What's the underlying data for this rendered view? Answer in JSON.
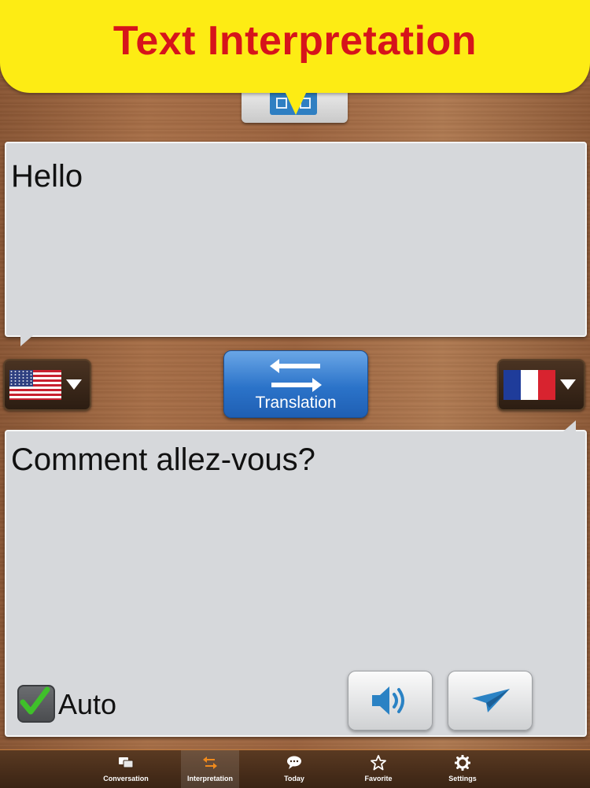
{
  "banner": {
    "title": "Text Interpretation"
  },
  "source": {
    "text": "Hello",
    "language_flag": "us-flag"
  },
  "target": {
    "text": "Comment allez-vous?",
    "language_flag": "france-flag"
  },
  "translate_button": {
    "label": "Translation",
    "icon": "swap-arrows-icon"
  },
  "auto": {
    "label": "Auto",
    "checked": true
  },
  "actions": {
    "speak_icon": "speaker-icon",
    "send_icon": "paper-plane-icon"
  },
  "tabs": [
    {
      "label": "Conversation",
      "icon": "chat-bubbles-icon",
      "active": false
    },
    {
      "label": "Interpretation",
      "icon": "swap-icon",
      "active": true
    },
    {
      "label": "Today",
      "icon": "speech-bubble-icon",
      "active": false
    },
    {
      "label": "Favorite",
      "icon": "star-icon",
      "active": false
    },
    {
      "label": "Settings",
      "icon": "gear-icon",
      "active": false
    }
  ],
  "colors": {
    "banner": "#fdec14",
    "banner_text": "#d6141b",
    "translate_button": "#2b73c9",
    "active_tab_icon": "#f08a1c"
  }
}
